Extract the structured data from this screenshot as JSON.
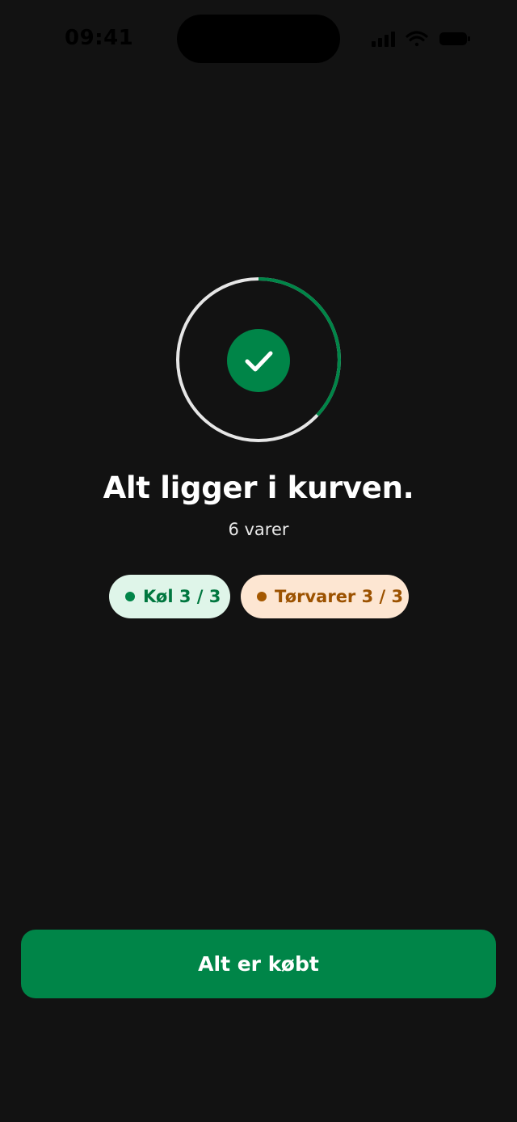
{
  "status_bar": {
    "time": "09:41",
    "icons": [
      "cellular-signal-icon",
      "wifi-icon",
      "battery-icon"
    ]
  },
  "completion": {
    "progress_fraction": 0.37,
    "ring_track_color": "#e6e6e6",
    "ring_progress_color": "#008548",
    "check_color": "#008548"
  },
  "headline": "Alt ligger i kurven.",
  "item_count": "6 varer",
  "categories": [
    {
      "label": "Køl 3 / 3",
      "color": "#008548",
      "background": "#dff5e9"
    },
    {
      "label": "Tørvarer 3 / 3",
      "color": "#a45800",
      "background": "#fde6d2"
    }
  ],
  "primary_button": {
    "label": "Alt er købt",
    "color": "#008548"
  }
}
